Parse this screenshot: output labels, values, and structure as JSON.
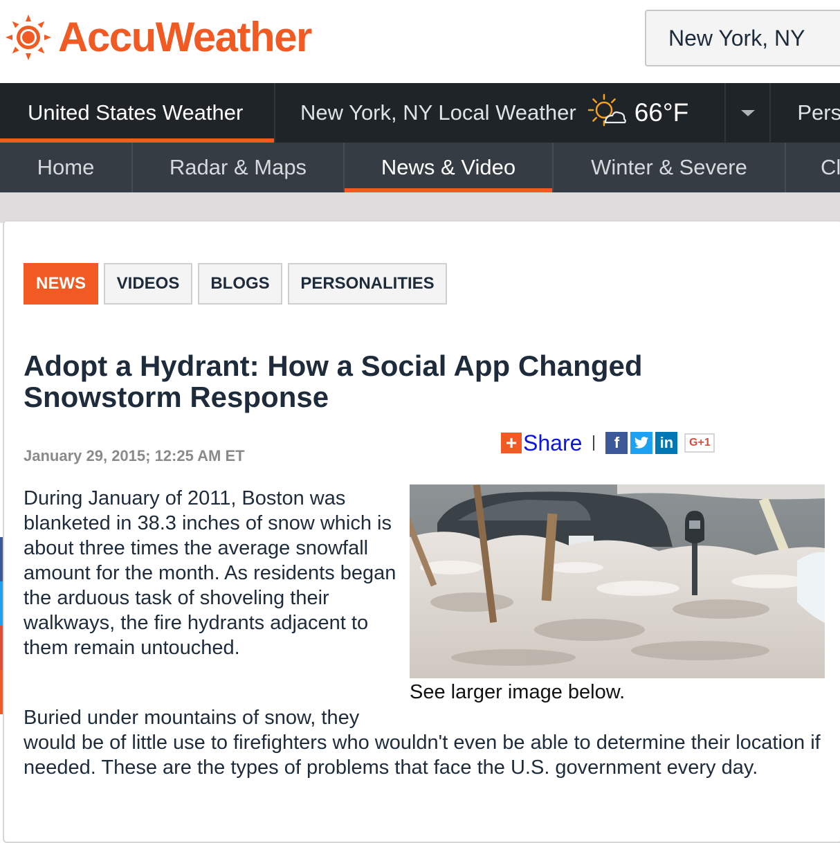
{
  "header": {
    "brand": "AccuWeather",
    "location_value": "New York, NY"
  },
  "nav_primary": {
    "us_weather": "United States Weather",
    "local_weather": "New York, NY Local Weather",
    "temperature": "66°F",
    "personal_partial": "Pers"
  },
  "nav_secondary": {
    "items": [
      "Home",
      "Radar & Maps",
      "News & Video",
      "Winter & Severe",
      "Cl"
    ],
    "active": "News & Video"
  },
  "tabs": {
    "items": [
      "NEWS",
      "VIDEOS",
      "BLOGS",
      "PERSONALITIES"
    ],
    "active": "NEWS"
  },
  "article": {
    "title": "Adopt a Hydrant: How a Social App Changed Snowstorm Response",
    "date": "January 29, 2015; 12:25 AM ET",
    "share_plus": "+",
    "share_label": "Share",
    "social": {
      "facebook": "f",
      "linkedin": "in",
      "googleplus": "G+1"
    },
    "paragraph1": "During January of 2011, Boston was blanketed in 38.3 inches of snow which is about three times the average snowfall amount for the month. As residents began the arduous task of shoveling their walkways, the fire hydrants adjacent to them remain untouched.",
    "image_caption": "See larger image below.",
    "paragraph2_part1": "Buried under mountains of snow, they",
    "paragraph2_part2": "would be of little use to firefighters who wouldn't even be able to determine their location if needed. These are the types of problems that face the U.S. government every day."
  },
  "colors": {
    "brand_orange": "#f15a22",
    "nav_dark": "#1f2429",
    "nav_secondary": "#353c43",
    "text_navy": "#1d2b3a"
  }
}
